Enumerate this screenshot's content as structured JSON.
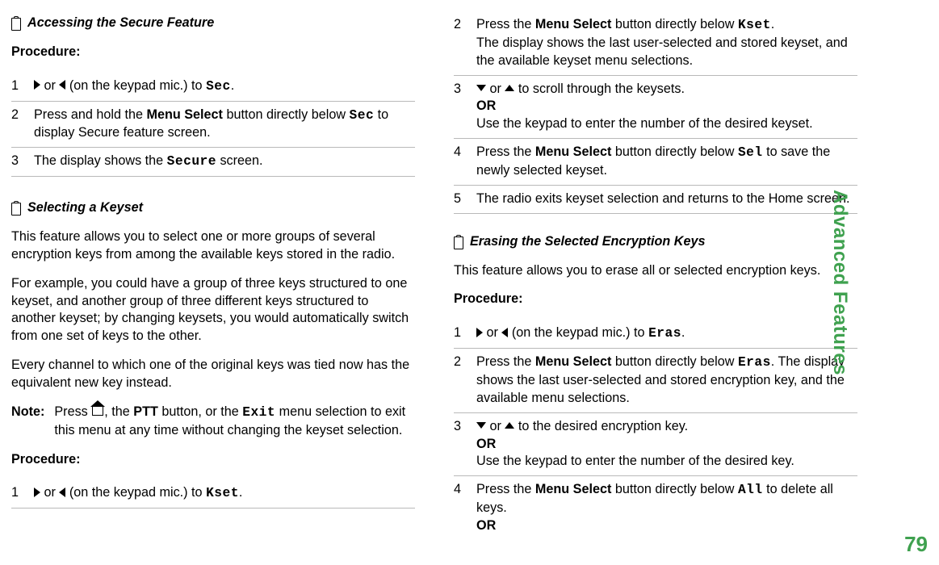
{
  "sidebar": {
    "label": "Advanced Features",
    "page_number": "79"
  },
  "left": {
    "sec1": {
      "title": "Accessing the Secure Feature",
      "procedure_label": "Procedure:",
      "steps": {
        "s1_pre": "or",
        "s1_mid": "(on the keypad mic.) to",
        "s1_code": "Sec",
        "s1_end": ".",
        "s2_a": "Press and hold the ",
        "s2_b": "Menu Select",
        "s2_c": " button directly below ",
        "s2_code": "Sec",
        "s2_d": " to display Secure feature screen.",
        "s3_a": "The display shows the ",
        "s3_code": "Secure",
        "s3_b": " screen."
      }
    },
    "sec2": {
      "title": "Selecting a Keyset",
      "intro1": "This feature allows you to select one or more groups of several encryption keys from among the available keys stored in the radio.",
      "intro2": "For example, you could have a group of three keys structured to one keyset, and another group of three different keys structured to another keyset; by changing keysets, you would automatically switch from one set of keys to the other.",
      "intro3": "Every channel to which one of the original keys was tied now has the equivalent new key instead.",
      "note_label": "Note:",
      "note_a": "Press ",
      "note_b": ", the ",
      "note_ptt": "PTT",
      "note_c": " button, or the ",
      "note_exit": "Exit",
      "note_d": " menu selection to exit this menu at any time without changing the keyset selection.",
      "procedure_label": "Procedure:",
      "steps": {
        "s1_pre": "or",
        "s1_mid": "(on the keypad mic.) to",
        "s1_code": "Kset",
        "s1_end": "."
      }
    }
  },
  "right": {
    "sec2cont": {
      "s2_a": "Press the ",
      "s2_b": "Menu Select",
      "s2_c": " button directly below ",
      "s2_code": "Kset",
      "s2_d": ".",
      "s2_e": "The display shows the last user-selected and stored keyset, and the available keyset menu selections.",
      "s3_or_mid": "or",
      "s3_tail": " to scroll through the keysets.",
      "s3_or": "OR",
      "s3_alt": "Use the keypad to enter the number of the desired keyset.",
      "s4_a": "Press the ",
      "s4_b": "Menu Select",
      "s4_c": " button directly below ",
      "s4_code": "Sel",
      "s4_d": " to save the newly selected keyset.",
      "s5": "The radio exits keyset selection and returns to the Home screen."
    },
    "sec3": {
      "title": "Erasing the Selected Encryption Keys",
      "intro": "This feature allows you to erase all or selected encryption keys.",
      "procedure_label": "Procedure:",
      "steps": {
        "s1_pre": "or",
        "s1_mid": "(on the keypad mic.) to",
        "s1_code": "Eras",
        "s1_end": ".",
        "s2_a": "Press the ",
        "s2_b": "Menu Select",
        "s2_c": " button directly below ",
        "s2_code": "Eras",
        "s2_d": ". The display shows the last user-selected and stored encryption key, and the available menu selections.",
        "s3_or_mid": "or",
        "s3_tail": " to the desired encryption key.",
        "s3_or": "OR",
        "s3_alt": "Use the keypad to enter the number of the desired key.",
        "s4_a": "Press the ",
        "s4_b": "Menu Select",
        "s4_c": " button directly below ",
        "s4_code": "All",
        "s4_d": " to delete all keys.",
        "s4_or": "OR"
      }
    }
  }
}
